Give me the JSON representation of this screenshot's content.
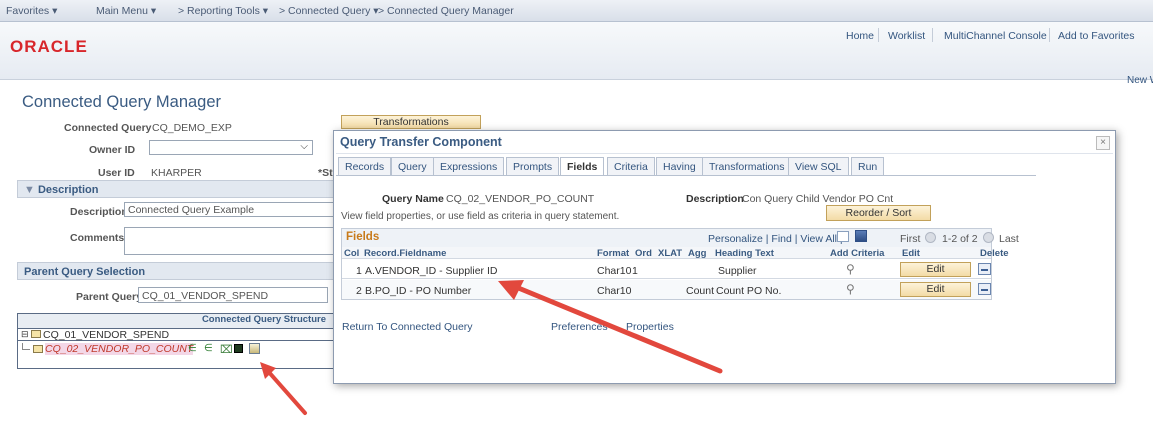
{
  "topnav": {
    "favorites": "Favorites ▾",
    "main_menu": "Main Menu ▾",
    "crumb1": "> Reporting Tools ▾",
    "crumb2": "> Connected Query ▾",
    "crumb3": "> Connected Query Manager"
  },
  "header": {
    "logo": "ORACLE",
    "links": [
      "Home",
      "Worklist",
      "MultiChannel Console",
      "Add to Favorites"
    ],
    "new_window": "New W"
  },
  "page": {
    "title": "Connected Query Manager",
    "transformations_button": "Transformations",
    "connected_query_label": "Connected Query",
    "connected_query_value": "CQ_DEMO_EXP",
    "owner_id_label": "Owner ID",
    "owner_id_value": "",
    "user_id_label": "User ID",
    "user_id_value": "KHARPER",
    "status_label_partial": "*St",
    "description_section": "Description",
    "description_label": "Description",
    "description_value": "Connected Query Example",
    "comments_label": "Comments",
    "parent_section": "Parent Query Selection",
    "parent_query_label": "Parent Query",
    "parent_query_value": "CQ_01_VENDOR_SPEND",
    "structure_title": "Connected Query Structure",
    "tree_root": "CQ_01_VENDOR_SPEND",
    "tree_child": "CQ_02_VENDOR_PO_COUNT"
  },
  "modal": {
    "title": "Query Transfer Component",
    "close": "×",
    "tabs": [
      "Records",
      "Query",
      "Expressions",
      "Prompts",
      "Fields",
      "Criteria",
      "Having",
      "Transformations",
      "View SQL",
      "Run"
    ],
    "active_tab": "Fields",
    "query_name_label": "Query Name",
    "query_name_value": "CQ_02_VENDOR_PO_COUNT",
    "description_label": "Description",
    "description_value": "Con Query Child Vendor PO Cnt",
    "instruction": "View field properties, or use field as criteria in query statement.",
    "reorder_button": "Reorder / Sort",
    "grid_title": "Fields",
    "grid_tools": "Personalize | Find | View All |",
    "pager_first": "First",
    "pager_range": "1-2 of 2",
    "pager_last": "Last",
    "columns": [
      "Col",
      "Record.Fieldname",
      "Format",
      "Ord",
      "XLAT",
      "Agg",
      "Heading Text",
      "Add Criteria",
      "Edit",
      "Delete"
    ],
    "rows": [
      {
        "col": "1",
        "field": "A.VENDOR_ID - Supplier ID",
        "format": "Char10",
        "ord": "1",
        "xlat": "",
        "agg": "",
        "heading": "Supplier",
        "edit": "Edit"
      },
      {
        "col": "2",
        "field": "B.PO_ID - PO Number",
        "format": "Char10",
        "ord": "",
        "xlat": "",
        "agg": "Count",
        "heading": "Count PO No.",
        "edit": "Edit"
      }
    ],
    "footer_links": [
      "Return To Connected Query",
      "Preferences",
      "Properties"
    ]
  },
  "colors": {
    "arrow": "#e2483d",
    "title_blue": "#3a5b82",
    "oracle_red": "#d8262b"
  }
}
